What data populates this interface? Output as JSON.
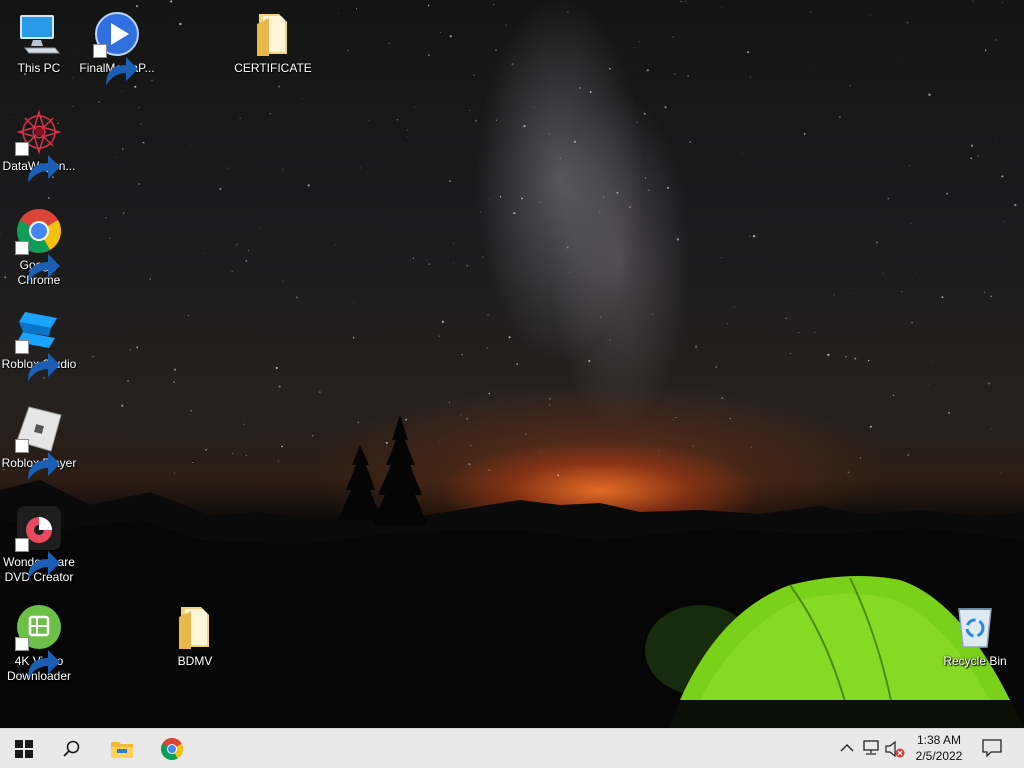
{
  "desktop": {
    "icons": [
      {
        "label": "This PC",
        "icon": "this-pc-icon"
      },
      {
        "label": "FinalMediaP...",
        "icon": "media-player-icon"
      },
      {
        "label": "CERTIFICATE",
        "icon": "folder-icon"
      },
      {
        "label": "DataWagon...",
        "icon": "datawagon-icon"
      },
      {
        "label": "Google Chrome",
        "icon": "chrome-icon"
      },
      {
        "label": "Roblox Studio",
        "icon": "roblox-studio-icon"
      },
      {
        "label": "Roblox Player",
        "icon": "roblox-player-icon"
      },
      {
        "label": "Wondershare DVD Creator",
        "icon": "dvd-creator-icon"
      },
      {
        "label": "4K Video Downloader",
        "icon": "video-downloader-icon"
      },
      {
        "label": "BDMV",
        "icon": "folder-icon"
      },
      {
        "label": "Recycle Bin",
        "icon": "recycle-bin-icon"
      }
    ]
  },
  "taskbar": {
    "buttons": [
      "start-icon",
      "search-icon",
      "file-explorer-icon",
      "chrome-icon"
    ],
    "tray": [
      "chevron-up-icon",
      "network-icon",
      "volume-muted-icon"
    ],
    "clock": {
      "time": "1:38 AM",
      "date": "2/5/2022"
    },
    "notification": "action-center-icon"
  },
  "colors": {
    "taskbar_bg": "#e9e9e9",
    "tent_green": "#7ad11a",
    "sunset_orange": "#e8702a"
  }
}
